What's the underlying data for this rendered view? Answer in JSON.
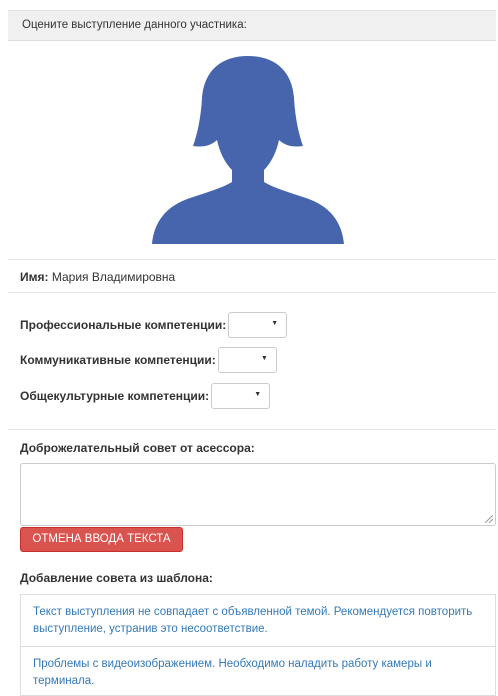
{
  "header": {
    "title": "Оцените выступление данного участника:"
  },
  "participant": {
    "avatar_icon": "female-user-silhouette-icon",
    "avatar_color": "#4665ad",
    "name_label": "Имя:",
    "name_value": "Мария Владимировна"
  },
  "competencies": [
    {
      "label": "Профессиональные компетенции:",
      "value": ""
    },
    {
      "label": "Коммуникативные компетенции:",
      "value": ""
    },
    {
      "label": "Общекультурные компетенции:",
      "value": ""
    }
  ],
  "advice": {
    "label": "Доброжелательный совет от асессора:",
    "text": "",
    "cancel_button": "ОТМЕНА ВВОДА ТЕКСТА"
  },
  "templates": {
    "label": "Добавление совета из шаблона:",
    "items": [
      "Текст выступления не совпадает с объявленной темой. Рекомендуется повторить выступление, устранив это несоответствие.",
      "Проблемы с видеоизображением. Необходимо наладить работу камеры и терминала."
    ]
  },
  "colors": {
    "danger": "#d9534f",
    "link": "#337ab7",
    "heading_bg": "#f0f0f0"
  }
}
